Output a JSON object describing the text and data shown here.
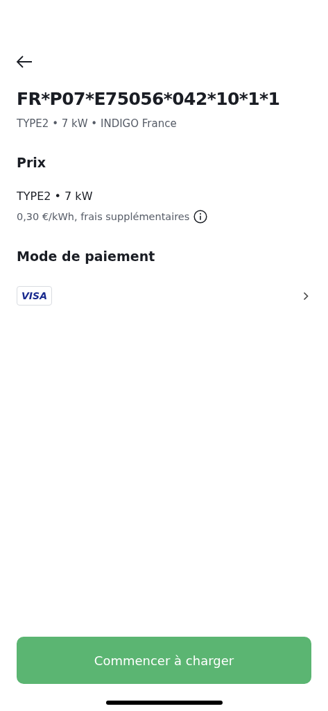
{
  "header": {
    "title": "FR*P07*E75056*042*10*1*1",
    "subtitle": "TYPE2 • 7 kW • INDIGO France"
  },
  "price": {
    "heading": "Prix",
    "connector": "TYPE2 • 7 kW",
    "rate": "0,30 €/kWh, frais supplémentaires"
  },
  "payment": {
    "heading": "Mode de paiement",
    "card_brand": "VISA"
  },
  "action_button": "Commencer à charger"
}
